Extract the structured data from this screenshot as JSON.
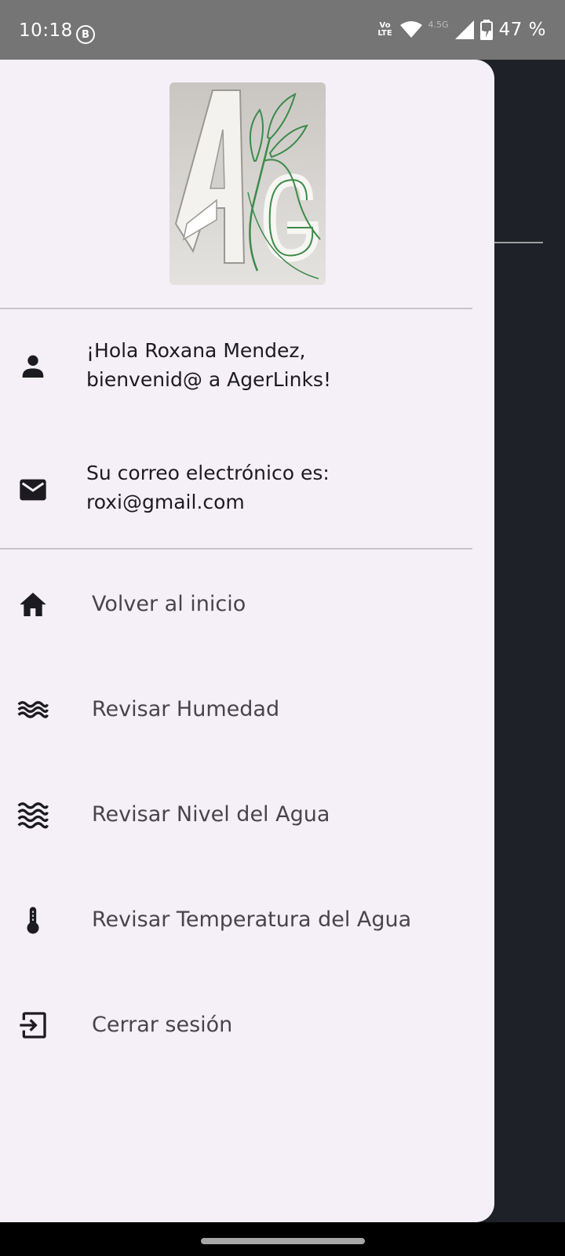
{
  "status_bar": {
    "time": "10:18",
    "notification_icon": "B",
    "volte_line1": "Vo",
    "volte_line2": "LTE",
    "network_type": "4.5G",
    "battery": "47 %"
  },
  "drawer": {
    "logo": {
      "icon": "agerlinks-logo",
      "text": "AG"
    },
    "user": {
      "icon": "person-icon",
      "greeting": "¡Hola Roxana  Mendez,\nbienvenid@ a AgerLinks!"
    },
    "email": {
      "icon": "mail-icon",
      "text": "Su correo electrónico es:\nroxi@gmail.com"
    },
    "menu": [
      {
        "icon": "home-icon",
        "label": "Volver al inicio"
      },
      {
        "icon": "humidity-waves-icon",
        "label": "Revisar Humedad"
      },
      {
        "icon": "water-level-icon",
        "label": "Revisar Nivel del Agua"
      },
      {
        "icon": "thermometer-icon",
        "label": "Revisar Temperatura del Agua"
      },
      {
        "icon": "logout-icon",
        "label": "Cerrar sesión"
      }
    ]
  },
  "colors": {
    "drawer_background": "#f5f0f7",
    "scrim": "#1f2128",
    "status_bar": "#757575",
    "icon": "#1c1b1f",
    "menu_text": "#47454a",
    "logo_green": "#3d8a4a"
  }
}
